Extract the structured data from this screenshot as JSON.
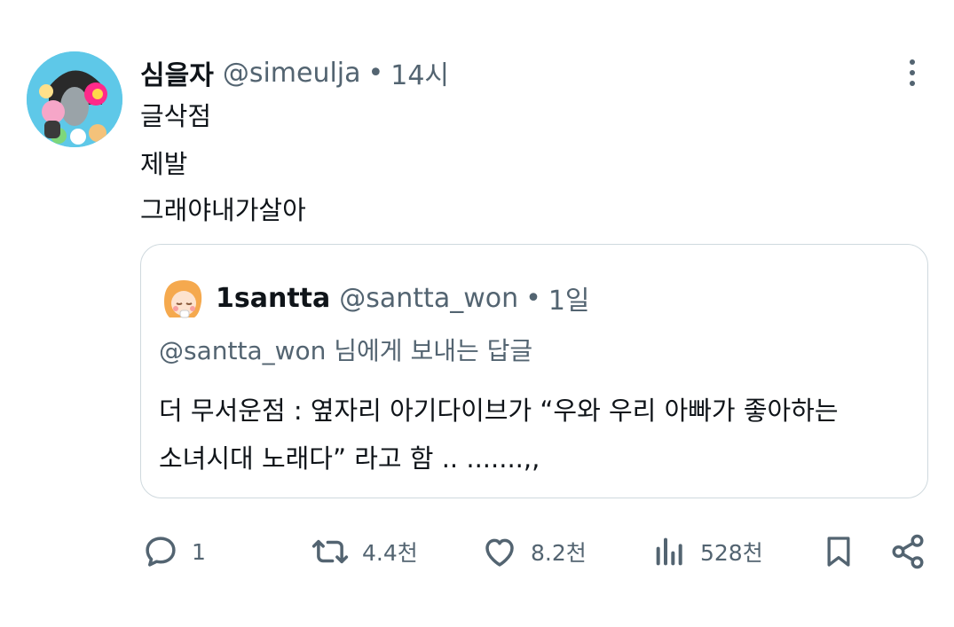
{
  "post": {
    "author": {
      "display_name": "심을자",
      "handle": "@simeulja"
    },
    "separator": "•",
    "time": "14시",
    "lines": [
      "글삭점",
      "제발",
      "그래야내가살아"
    ]
  },
  "quoted_post": {
    "author": {
      "display_name": "1santta",
      "handle": "@santta_won"
    },
    "separator": "•",
    "time": "1일",
    "replying_to": "@santta_won 님에게 보내는 답글",
    "text_lines": [
      "더 무서운점 : 옆자리 아기다이브가 “우와 우리 아빠가 좋아하는",
      "소녀시대 노래다” 라고 함 .. .......,,"
    ]
  },
  "actions": {
    "reply": {
      "icon": "reply-icon",
      "count": "1"
    },
    "repost": {
      "icon": "repost-icon",
      "count": "4.4천"
    },
    "like": {
      "icon": "heart-icon",
      "count": "8.2천"
    },
    "views": {
      "icon": "views-icon",
      "count": "528천"
    },
    "bookmark": {
      "icon": "bookmark-icon"
    },
    "share": {
      "icon": "share-icon"
    }
  },
  "colors": {
    "text": "#0f1419",
    "secondary": "#536471",
    "border": "#cfd9de"
  }
}
